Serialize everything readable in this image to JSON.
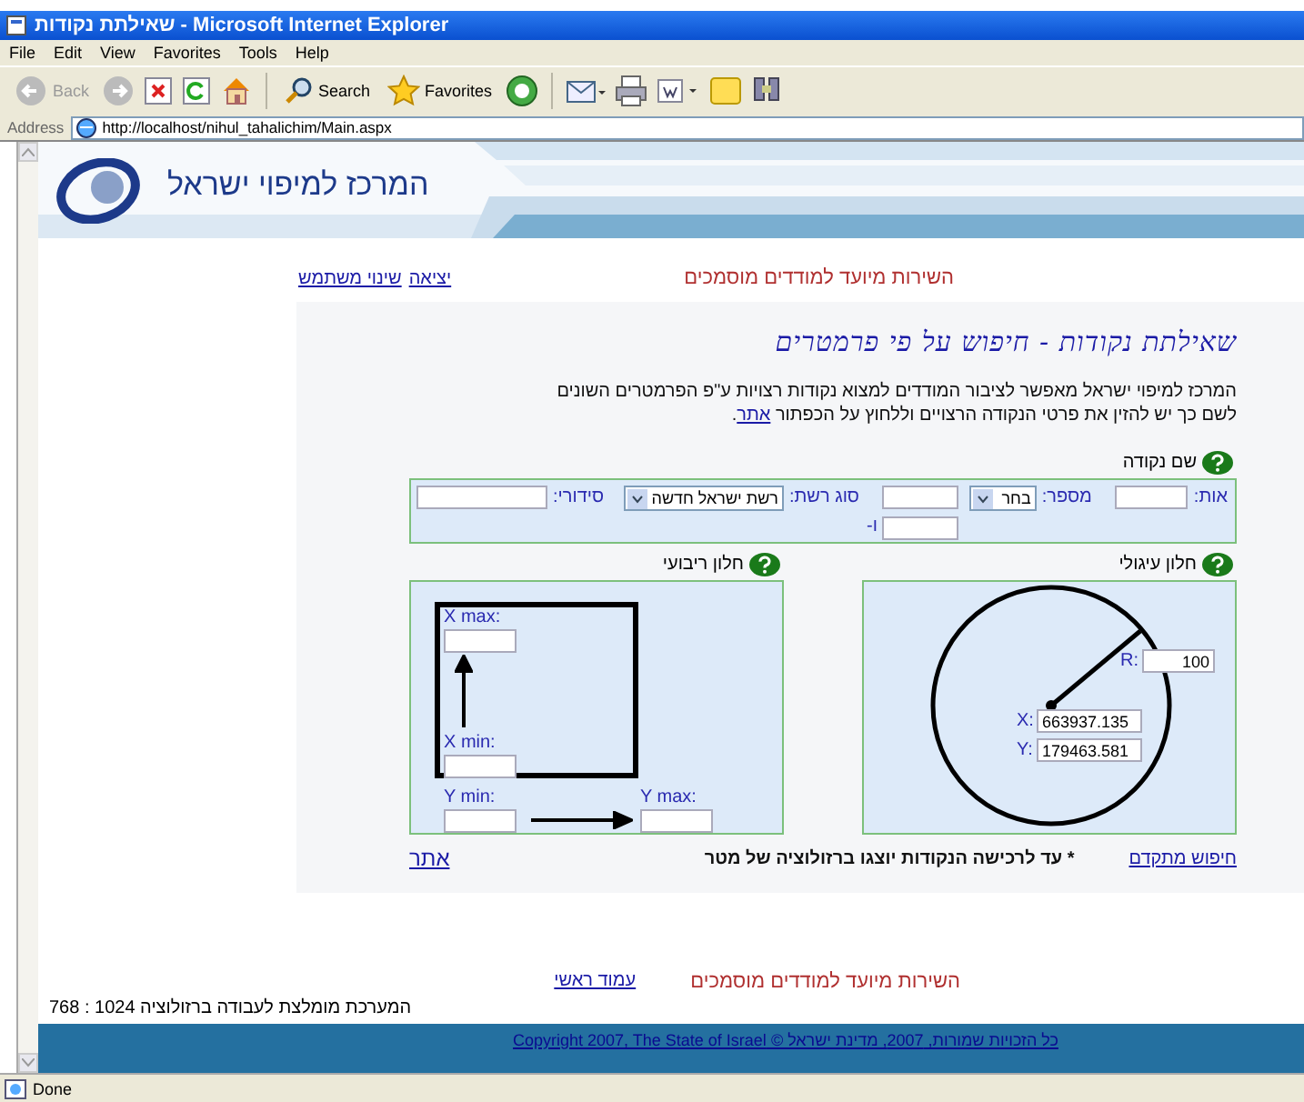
{
  "window": {
    "title": "שאילתת נקודות - Microsoft Internet Explorer"
  },
  "menu": {
    "file": "File",
    "edit": "Edit",
    "view": "View",
    "favorites": "Favorites",
    "tools": "Tools",
    "help": "Help"
  },
  "toolbar": {
    "back": {
      "label": "Back",
      "disabled": true
    },
    "search": "Search",
    "favorites": "Favorites"
  },
  "address": {
    "label": "Address",
    "url": "http://localhost/nihul_tahalichim/Main.aspx"
  },
  "header": {
    "site_name": "המרכז למיפוי ישראל"
  },
  "top_bar": {
    "links": [
      "יציאה",
      "שינוי משתמש"
    ],
    "notice": "השירות מיועד למודדים מוסמכים"
  },
  "query": {
    "title": "שאילתת נקודות - חיפוש על פי פרמטרים",
    "intro_line1": "המרכז למיפוי ישראל מאפשר לציבור המודדים למצוא נקודות רצויות ע\"פ הפרמטרים השונים",
    "intro_line2": "לשם כך יש להזין את פרטי הנקודה הרצויים וללחוץ על הכפתור ",
    "intro_link": "אתר",
    "intro_end": ".",
    "point_name": {
      "heading": "שם נקודה",
      "letter_label": "אות:",
      "number_label": "מספר:",
      "number_select": "בחר",
      "and_label": "ו-",
      "network_label": "סוג רשת:",
      "network_select": "רשת ישראל חדשה",
      "serial_label": "סידורי:"
    },
    "circle": {
      "heading": "חלון עיגולי",
      "r_label": "R:",
      "r_value": "100",
      "x_label": "X:",
      "x_value": "663937.135",
      "y_label": "Y:",
      "y_value": "179463.581"
    },
    "rectangle": {
      "heading": "חלון ריבועי",
      "xmax_label": "X max:",
      "xmin_label": "X min:",
      "ymin_label": "Y min:",
      "ymax_label": "Y max:"
    },
    "advanced_link": "חיפוש מתקדם",
    "note": "* עד לרכישה הנקודות יוצגו ברזולוציה של מטר",
    "submit_link": "אתר"
  },
  "footer": {
    "notice": "השירות מיועד למודדים מוסמכים",
    "home_link": "עמוד ראשי",
    "resolution": "המערכת מומלצת לעבודה ברזולוציה 1024 : 768",
    "copyright": "כל הזכויות שמורות, 2007, מדינת ישראל © Copyright 2007, The State of Israel"
  },
  "status_bar": {
    "text": "Done"
  }
}
